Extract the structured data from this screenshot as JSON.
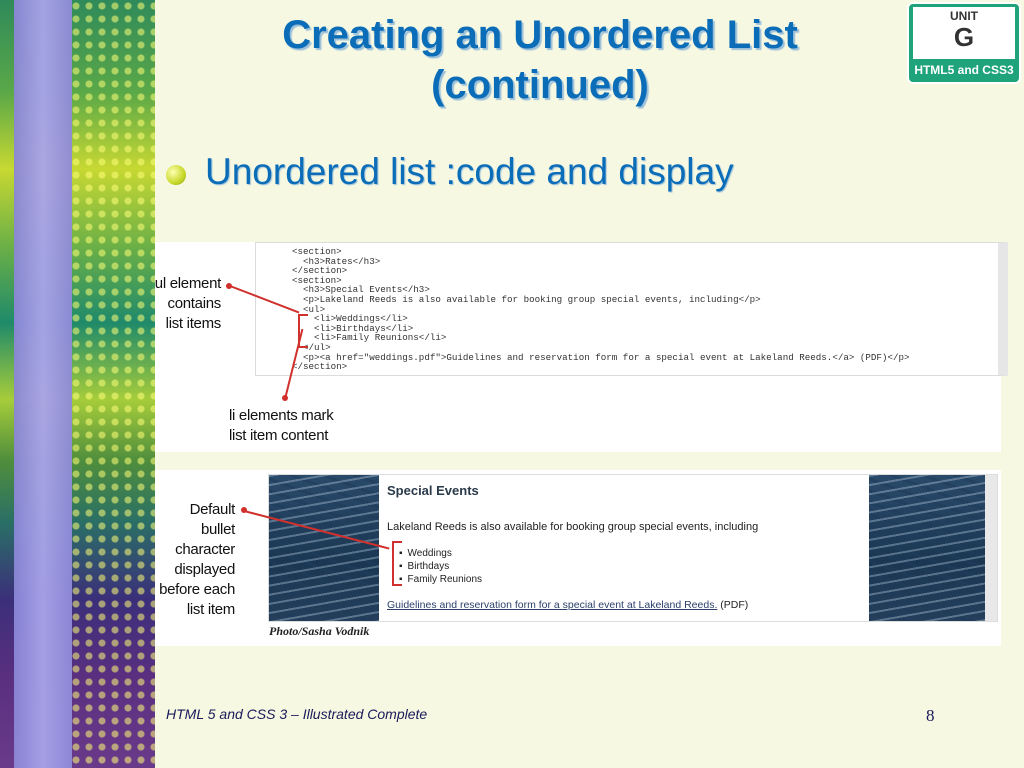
{
  "slide": {
    "title_line1": "Creating an Unordered List",
    "title_line2": "(continued)",
    "bullet": "Unordered list :code and display",
    "footer": "HTML 5 and CSS 3 – Illustrated Complete",
    "page_number": "8"
  },
  "badge": {
    "unit_word": "UNIT",
    "unit_letter": "G",
    "subtitle": "HTML5 and CSS3"
  },
  "code_figure": {
    "callout_ul": [
      "ul element",
      "contains",
      "list items"
    ],
    "callout_li": [
      "li elements mark",
      "list item content"
    ],
    "code_lines": [
      "<section>",
      "  <h3>Rates</h3>",
      "</section>",
      "<section>",
      "  <h3>Special Events</h3>",
      "  <p>Lakeland Reeds is also available for booking group special events, including</p>",
      "  <ul>",
      "    <li>Weddings</li>",
      "    <li>Birthdays</li>",
      "    <li>Family Reunions</li>",
      "  </ul>",
      "  <p><a href=\"weddings.pdf\">Guidelines and reservation form for a special event at Lakeland Reeds.</a> (PDF)</p>",
      "</section>"
    ]
  },
  "display_figure": {
    "callout": [
      "Default",
      "bullet",
      "character",
      "displayed",
      "before each",
      "list item"
    ],
    "heading": "Special Events",
    "paragraph": "Lakeland Reeds is also available for booking group special events, including",
    "list_items": [
      "Weddings",
      "Birthdays",
      "Family Reunions"
    ],
    "link_text": "Guidelines and reservation form for a special event at Lakeland Reeds.",
    "link_suffix": " (PDF)",
    "photo_credit": "Photo/Sasha Vodnik"
  }
}
